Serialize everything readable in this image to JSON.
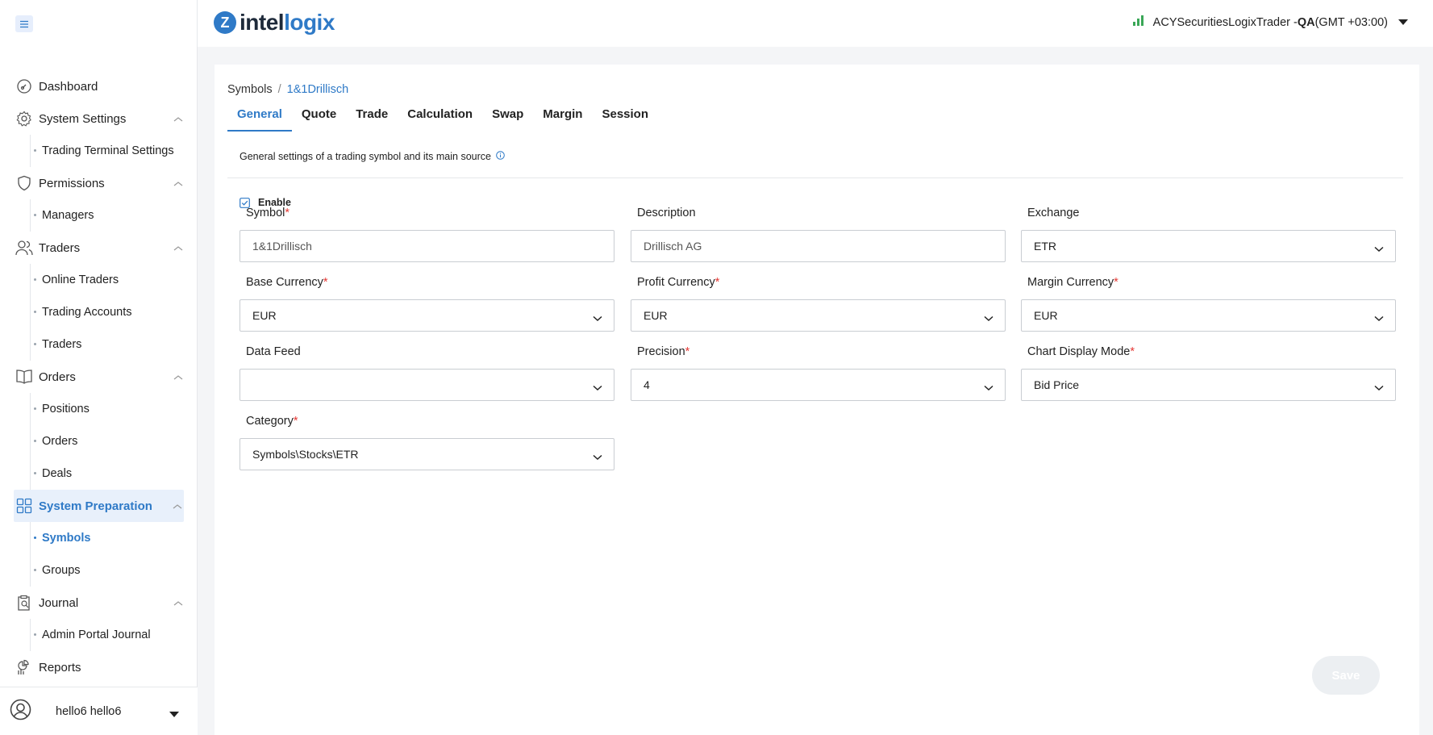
{
  "app": {
    "logo_mark": "Z",
    "logo_name_a": "intel",
    "logo_name_b": "logix"
  },
  "header": {
    "account_name": "ACYSecuritiesLogixTrader - ",
    "environment": "QA",
    "timezone": "(GMT +03:00)",
    "signal_icon": "signal-icon"
  },
  "sidebar": {
    "items": [
      {
        "label": "Dashboard",
        "icon": "dashboard-icon"
      },
      {
        "label": "System Settings",
        "icon": "gear-icon",
        "sub": [
          "Trading Terminal Settings"
        ]
      },
      {
        "label": "Permissions",
        "icon": "shield-icon",
        "sub": [
          "Managers"
        ]
      },
      {
        "label": "Traders",
        "icon": "users-icon",
        "sub": [
          "Online Traders",
          "Trading Accounts",
          "Traders"
        ]
      },
      {
        "label": "Orders",
        "icon": "book-icon",
        "sub": [
          "Positions",
          "Orders",
          "Deals"
        ]
      },
      {
        "label": "System Preparation",
        "icon": "grid-icon",
        "sub": [
          "Symbols",
          "Groups"
        ]
      },
      {
        "label": "Journal",
        "icon": "journal-icon",
        "sub": [
          "Admin Portal Journal"
        ]
      },
      {
        "label": "Reports",
        "icon": "reports-icon"
      }
    ],
    "user": "hello6 hello6"
  },
  "breadcrumb": {
    "root": "Symbols",
    "separator": "/",
    "current": "1&1Drillisch"
  },
  "tabs": [
    "General",
    "Quote",
    "Trade",
    "Calculation",
    "Swap",
    "Margin",
    "Session"
  ],
  "active_tab": "General",
  "description": "General settings of a trading symbol and its main source",
  "enable": {
    "label": "Enable",
    "checked": true
  },
  "form": {
    "symbol": {
      "label": "Symbol",
      "value": "1&1Drillisch",
      "required": "*"
    },
    "description": {
      "label": "Description",
      "value": "Drillisch AG"
    },
    "exchange": {
      "label": "Exchange",
      "value": "ETR"
    },
    "base_currency": {
      "label": "Base Currency",
      "value": "EUR",
      "required": "*"
    },
    "profit_currency": {
      "label": "Profit Currency",
      "value": "EUR",
      "required": "*"
    },
    "margin_currency": {
      "label": "Margin Currency",
      "value": "EUR",
      "required": "*"
    },
    "data_feed": {
      "label": "Data Feed",
      "value": ""
    },
    "precision": {
      "label": "Precision",
      "value": "4",
      "required": "*"
    },
    "chart_display_mode": {
      "label": "Chart Display Mode",
      "value": "Bid Price",
      "required": "*"
    },
    "category": {
      "label": "Category",
      "value": "Symbols\\Stocks\\ETR",
      "required": "*"
    }
  },
  "save_label": "Save",
  "colors": {
    "accent": "#2f7ac7",
    "required": "#e53935",
    "active_bg": "#e8f0fb"
  }
}
